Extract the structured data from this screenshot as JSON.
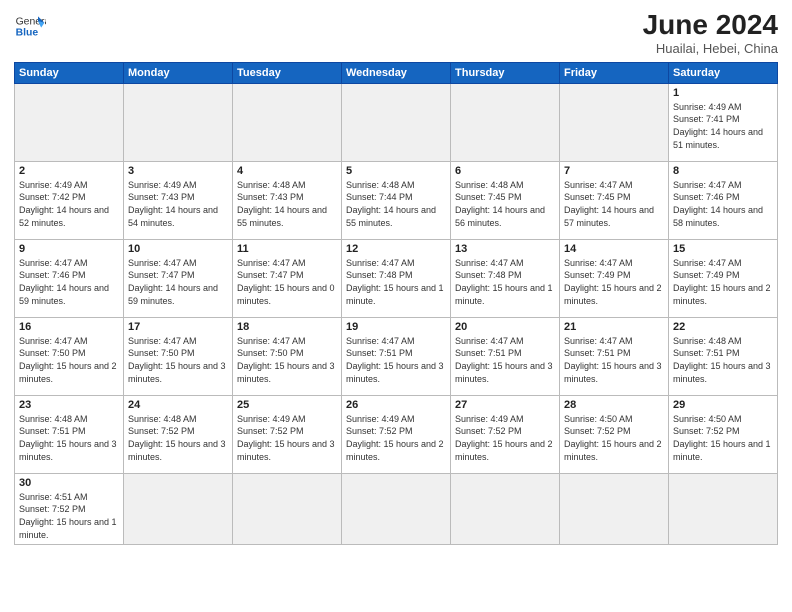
{
  "logo": {
    "text_general": "General",
    "text_blue": "Blue"
  },
  "title": "June 2024",
  "subtitle": "Huailai, Hebei, China",
  "weekdays": [
    "Sunday",
    "Monday",
    "Tuesday",
    "Wednesday",
    "Thursday",
    "Friday",
    "Saturday"
  ],
  "weeks": [
    [
      {
        "day": "",
        "info": ""
      },
      {
        "day": "",
        "info": ""
      },
      {
        "day": "",
        "info": ""
      },
      {
        "day": "",
        "info": ""
      },
      {
        "day": "",
        "info": ""
      },
      {
        "day": "",
        "info": ""
      },
      {
        "day": "1",
        "info": "Sunrise: 4:49 AM\nSunset: 7:41 PM\nDaylight: 14 hours\nand 51 minutes."
      }
    ],
    [
      {
        "day": "2",
        "info": "Sunrise: 4:49 AM\nSunset: 7:42 PM\nDaylight: 14 hours\nand 52 minutes."
      },
      {
        "day": "3",
        "info": "Sunrise: 4:49 AM\nSunset: 7:43 PM\nDaylight: 14 hours\nand 54 minutes."
      },
      {
        "day": "4",
        "info": "Sunrise: 4:48 AM\nSunset: 7:43 PM\nDaylight: 14 hours\nand 55 minutes."
      },
      {
        "day": "5",
        "info": "Sunrise: 4:48 AM\nSunset: 7:44 PM\nDaylight: 14 hours\nand 55 minutes."
      },
      {
        "day": "6",
        "info": "Sunrise: 4:48 AM\nSunset: 7:45 PM\nDaylight: 14 hours\nand 56 minutes."
      },
      {
        "day": "7",
        "info": "Sunrise: 4:47 AM\nSunset: 7:45 PM\nDaylight: 14 hours\nand 57 minutes."
      },
      {
        "day": "8",
        "info": "Sunrise: 4:47 AM\nSunset: 7:46 PM\nDaylight: 14 hours\nand 58 minutes."
      }
    ],
    [
      {
        "day": "9",
        "info": "Sunrise: 4:47 AM\nSunset: 7:46 PM\nDaylight: 14 hours\nand 59 minutes."
      },
      {
        "day": "10",
        "info": "Sunrise: 4:47 AM\nSunset: 7:47 PM\nDaylight: 14 hours\nand 59 minutes."
      },
      {
        "day": "11",
        "info": "Sunrise: 4:47 AM\nSunset: 7:47 PM\nDaylight: 15 hours\nand 0 minutes."
      },
      {
        "day": "12",
        "info": "Sunrise: 4:47 AM\nSunset: 7:48 PM\nDaylight: 15 hours\nand 1 minute."
      },
      {
        "day": "13",
        "info": "Sunrise: 4:47 AM\nSunset: 7:48 PM\nDaylight: 15 hours\nand 1 minute."
      },
      {
        "day": "14",
        "info": "Sunrise: 4:47 AM\nSunset: 7:49 PM\nDaylight: 15 hours\nand 2 minutes."
      },
      {
        "day": "15",
        "info": "Sunrise: 4:47 AM\nSunset: 7:49 PM\nDaylight: 15 hours\nand 2 minutes."
      }
    ],
    [
      {
        "day": "16",
        "info": "Sunrise: 4:47 AM\nSunset: 7:50 PM\nDaylight: 15 hours\nand 2 minutes."
      },
      {
        "day": "17",
        "info": "Sunrise: 4:47 AM\nSunset: 7:50 PM\nDaylight: 15 hours\nand 3 minutes."
      },
      {
        "day": "18",
        "info": "Sunrise: 4:47 AM\nSunset: 7:50 PM\nDaylight: 15 hours\nand 3 minutes."
      },
      {
        "day": "19",
        "info": "Sunrise: 4:47 AM\nSunset: 7:51 PM\nDaylight: 15 hours\nand 3 minutes."
      },
      {
        "day": "20",
        "info": "Sunrise: 4:47 AM\nSunset: 7:51 PM\nDaylight: 15 hours\nand 3 minutes."
      },
      {
        "day": "21",
        "info": "Sunrise: 4:47 AM\nSunset: 7:51 PM\nDaylight: 15 hours\nand 3 minutes."
      },
      {
        "day": "22",
        "info": "Sunrise: 4:48 AM\nSunset: 7:51 PM\nDaylight: 15 hours\nand 3 minutes."
      }
    ],
    [
      {
        "day": "23",
        "info": "Sunrise: 4:48 AM\nSunset: 7:51 PM\nDaylight: 15 hours\nand 3 minutes."
      },
      {
        "day": "24",
        "info": "Sunrise: 4:48 AM\nSunset: 7:52 PM\nDaylight: 15 hours\nand 3 minutes."
      },
      {
        "day": "25",
        "info": "Sunrise: 4:49 AM\nSunset: 7:52 PM\nDaylight: 15 hours\nand 3 minutes."
      },
      {
        "day": "26",
        "info": "Sunrise: 4:49 AM\nSunset: 7:52 PM\nDaylight: 15 hours\nand 2 minutes."
      },
      {
        "day": "27",
        "info": "Sunrise: 4:49 AM\nSunset: 7:52 PM\nDaylight: 15 hours\nand 2 minutes."
      },
      {
        "day": "28",
        "info": "Sunrise: 4:50 AM\nSunset: 7:52 PM\nDaylight: 15 hours\nand 2 minutes."
      },
      {
        "day": "29",
        "info": "Sunrise: 4:50 AM\nSunset: 7:52 PM\nDaylight: 15 hours\nand 1 minute."
      }
    ],
    [
      {
        "day": "30",
        "info": "Sunrise: 4:51 AM\nSunset: 7:52 PM\nDaylight: 15 hours\nand 1 minute."
      },
      {
        "day": "",
        "info": ""
      },
      {
        "day": "",
        "info": ""
      },
      {
        "day": "",
        "info": ""
      },
      {
        "day": "",
        "info": ""
      },
      {
        "day": "",
        "info": ""
      },
      {
        "day": "",
        "info": ""
      }
    ]
  ]
}
